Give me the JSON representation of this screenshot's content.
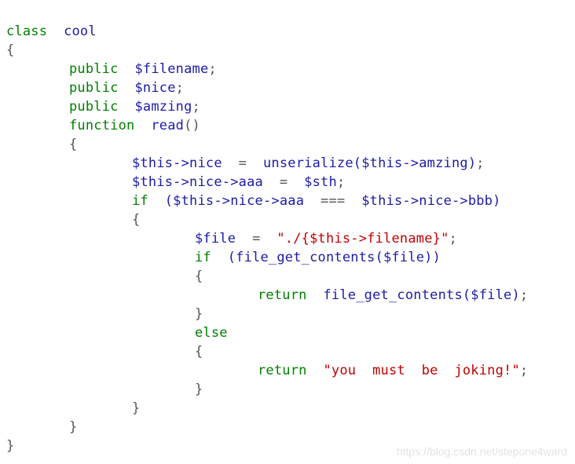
{
  "code": {
    "lines": [
      {
        "indent": 0,
        "tokens": [
          {
            "t": "kw",
            "v": "class"
          },
          {
            "t": "id",
            "v": "cool"
          }
        ]
      },
      {
        "indent": 0,
        "tokens": [
          {
            "t": "sym",
            "v": "{"
          }
        ]
      },
      {
        "indent": 1,
        "tokens": [
          {
            "t": "kw",
            "v": "public"
          },
          {
            "t": "id",
            "v": "$filename"
          },
          {
            "t": "sym",
            "v": ";"
          }
        ]
      },
      {
        "indent": 1,
        "tokens": [
          {
            "t": "kw",
            "v": "public"
          },
          {
            "t": "id",
            "v": "$nice"
          },
          {
            "t": "sym",
            "v": ";"
          }
        ]
      },
      {
        "indent": 1,
        "tokens": [
          {
            "t": "kw",
            "v": "public"
          },
          {
            "t": "id",
            "v": "$amzing"
          },
          {
            "t": "sym",
            "v": ";"
          }
        ]
      },
      {
        "indent": 1,
        "tokens": [
          {
            "t": "kw",
            "v": "function"
          },
          {
            "t": "id",
            "v": "read"
          },
          {
            "t": "sym",
            "v": "()"
          }
        ]
      },
      {
        "indent": 1,
        "tokens": [
          {
            "t": "sym",
            "v": "{"
          }
        ]
      },
      {
        "indent": 2,
        "tokens": [
          {
            "t": "id",
            "v": "$this->nice"
          },
          {
            "t": "sym",
            "v": "="
          },
          {
            "t": "id",
            "v": "unserialize($this->amzing)"
          },
          {
            "t": "sym",
            "v": ";"
          }
        ]
      },
      {
        "indent": 2,
        "tokens": [
          {
            "t": "id",
            "v": "$this->nice->aaa"
          },
          {
            "t": "sym",
            "v": "="
          },
          {
            "t": "id",
            "v": "$sth"
          },
          {
            "t": "sym",
            "v": ";"
          }
        ]
      },
      {
        "indent": 2,
        "tokens": [
          {
            "t": "kw",
            "v": "if"
          },
          {
            "t": "id",
            "v": "($this->nice->aaa"
          },
          {
            "t": "sym",
            "v": "==="
          },
          {
            "t": "id",
            "v": "$this->nice->bbb)"
          }
        ]
      },
      {
        "indent": 2,
        "tokens": [
          {
            "t": "sym",
            "v": "{"
          }
        ]
      },
      {
        "indent": 3,
        "tokens": [
          {
            "t": "id",
            "v": "$file"
          },
          {
            "t": "sym",
            "v": "="
          },
          {
            "t": "str",
            "v": "\"./{$this->filename}\""
          },
          {
            "t": "sym",
            "v": ";"
          }
        ]
      },
      {
        "indent": 3,
        "tokens": [
          {
            "t": "kw",
            "v": "if"
          },
          {
            "t": "id",
            "v": "(file_get_contents($file))"
          }
        ]
      },
      {
        "indent": 3,
        "tokens": [
          {
            "t": "sym",
            "v": "{"
          }
        ]
      },
      {
        "indent": 4,
        "tokens": [
          {
            "t": "kw",
            "v": "return"
          },
          {
            "t": "id",
            "v": "file_get_contents($file)"
          },
          {
            "t": "sym",
            "v": ";"
          }
        ]
      },
      {
        "indent": 3,
        "tokens": [
          {
            "t": "sym",
            "v": "}"
          }
        ]
      },
      {
        "indent": 3,
        "tokens": [
          {
            "t": "kw",
            "v": "else"
          }
        ]
      },
      {
        "indent": 3,
        "tokens": [
          {
            "t": "sym",
            "v": "{"
          }
        ]
      },
      {
        "indent": 4,
        "tokens": [
          {
            "t": "kw",
            "v": "return"
          },
          {
            "t": "str",
            "v": "\"you  must  be  joking!\""
          },
          {
            "t": "sym",
            "v": ";"
          }
        ]
      },
      {
        "indent": 3,
        "tokens": [
          {
            "t": "sym",
            "v": "}"
          }
        ]
      },
      {
        "indent": 2,
        "tokens": [
          {
            "t": "sym",
            "v": "}"
          }
        ]
      },
      {
        "indent": 1,
        "tokens": [
          {
            "t": "sym",
            "v": "}"
          }
        ]
      },
      {
        "indent": 0,
        "tokens": [
          {
            "t": "sym",
            "v": "}"
          }
        ]
      }
    ]
  },
  "watermark": "https://blog.csdn.net/stepone4ward",
  "colors": {
    "keyword": "#008000",
    "identifier": "#1c1ca8",
    "string": "#c00000",
    "symbol": "#555555",
    "background": "#ffffff"
  }
}
